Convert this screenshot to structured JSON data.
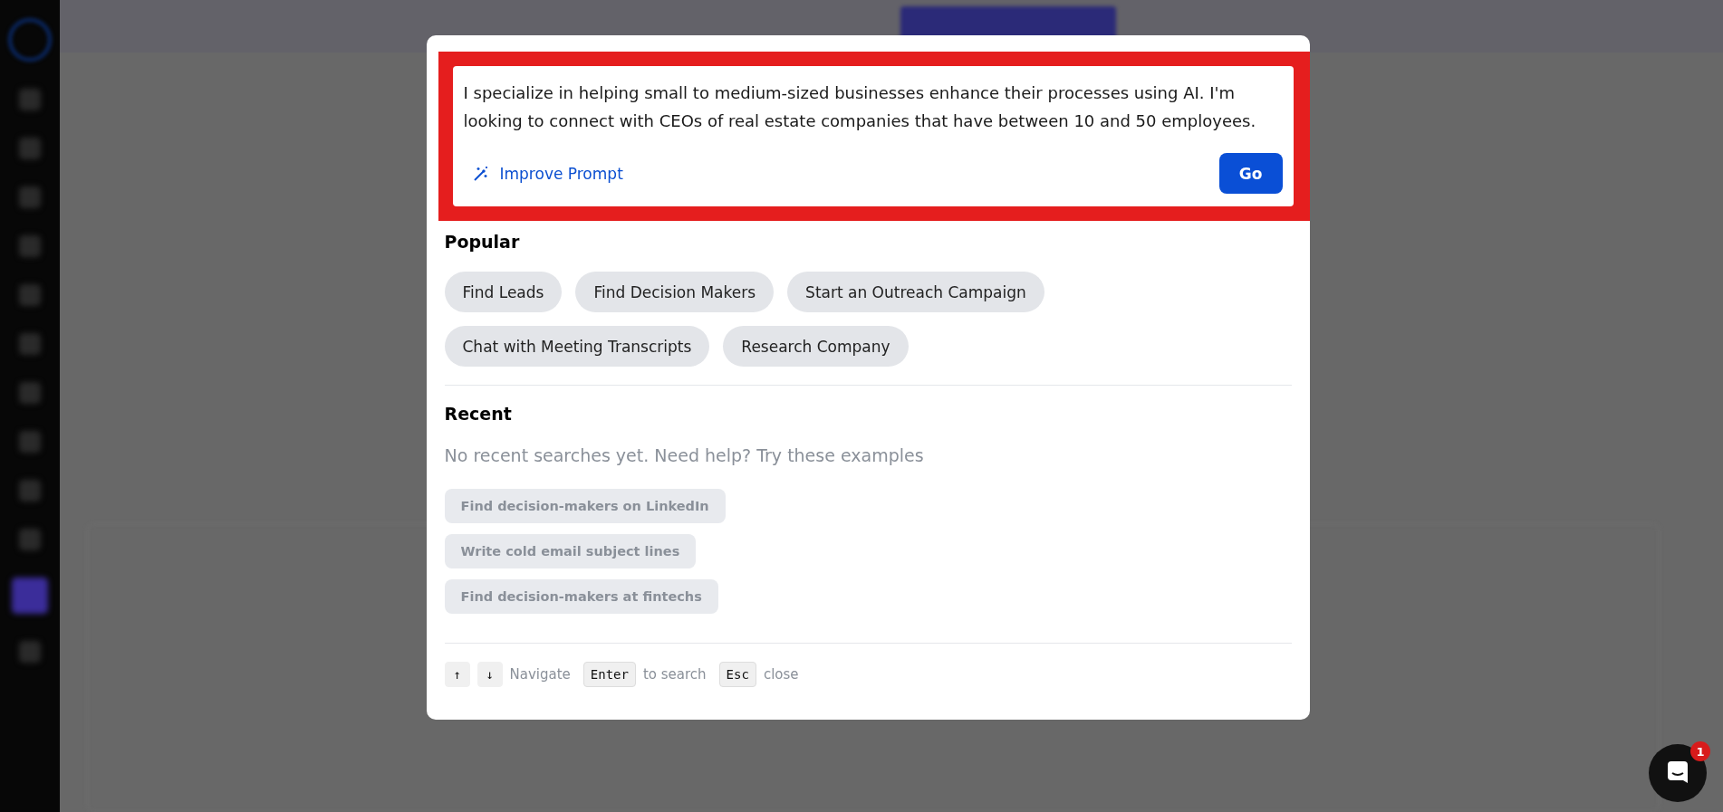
{
  "prompt": {
    "value": "I specialize in helping small to medium-sized businesses enhance their processes using AI. I'm looking to connect with CEOs of real estate companies that have between 10 and 50 employees.",
    "improve_label": "Improve Prompt",
    "submit_label": "Go"
  },
  "popular": {
    "title": "Popular",
    "items": [
      "Find Leads",
      "Find Decision Makers",
      "Start an Outreach Campaign",
      "Chat with Meeting Transcripts",
      "Research Company"
    ]
  },
  "recent": {
    "title": "Recent",
    "empty_text": "No recent searches yet. Need help? Try these examples",
    "examples": [
      "Find decision-makers on LinkedIn",
      "Write cold email subject lines",
      "Find decision-makers at fintechs"
    ]
  },
  "shortcuts": [
    {
      "keys": [
        "↑",
        "↓"
      ],
      "label": "Navigate"
    },
    {
      "keys": [
        "Enter"
      ],
      "label": "to search"
    },
    {
      "keys": [
        "Esc"
      ],
      "label": "close"
    }
  ],
  "chat": {
    "badge": "1"
  }
}
